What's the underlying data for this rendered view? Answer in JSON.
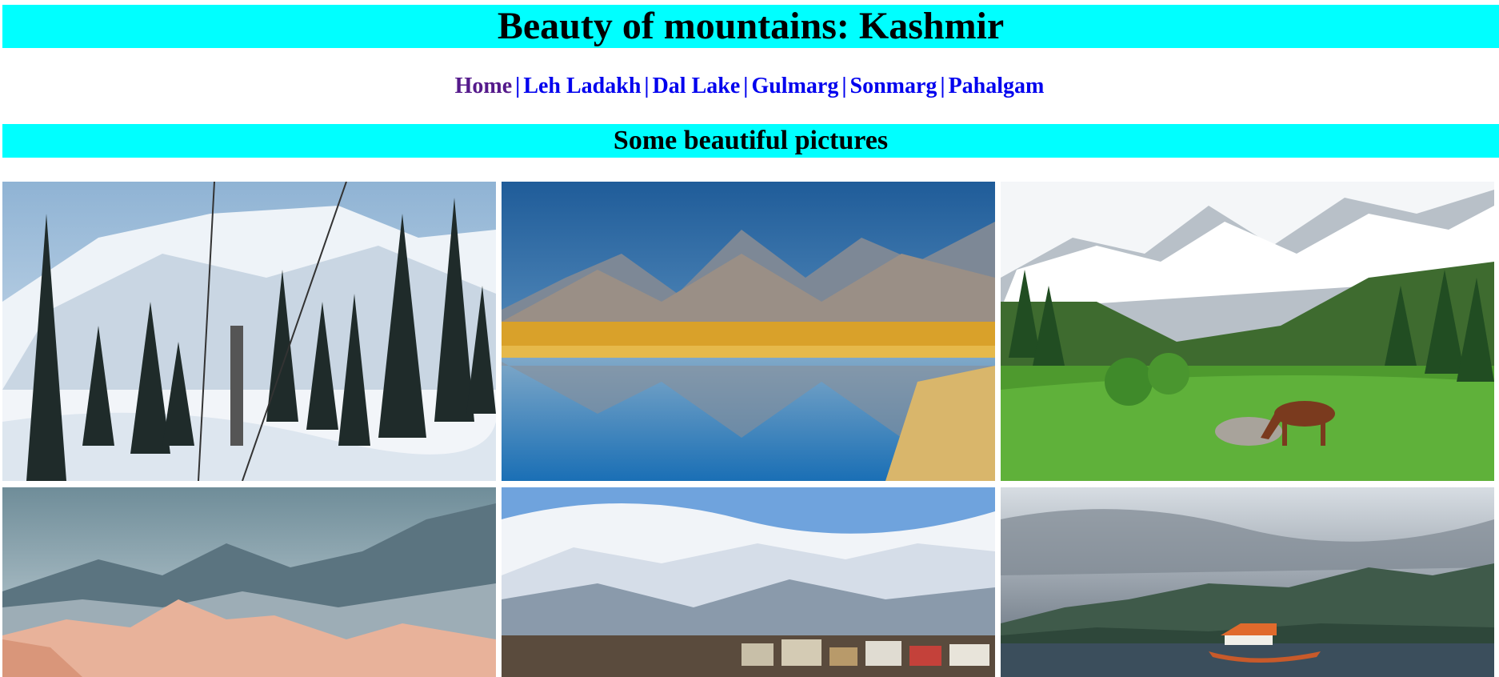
{
  "header": {
    "title": "Beauty of mountains: Kashmir"
  },
  "nav": {
    "items": [
      {
        "label": "Home",
        "color": "#551a8b"
      },
      {
        "label": "Leh Ladakh",
        "color": "#0000ee"
      },
      {
        "label": "Dal Lake",
        "color": "#0000ee"
      },
      {
        "label": "Gulmarg",
        "color": "#0000ee"
      },
      {
        "label": "Sonmarg",
        "color": "#0000ee"
      },
      {
        "label": "Pahalgam",
        "color": "#0000ee"
      }
    ],
    "separator": "|"
  },
  "section": {
    "heading": "Some beautiful pictures"
  },
  "colors": {
    "banner": "#00ffff",
    "link": "#0000ee",
    "visited": "#551a8b"
  },
  "gallery": {
    "images": [
      {
        "scene": "snowy-forest-gondola"
      },
      {
        "scene": "mountain-lake-reflection"
      },
      {
        "scene": "green-valley-horse"
      },
      {
        "scene": "misty-pink-peaks"
      },
      {
        "scene": "snow-range-town"
      },
      {
        "scene": "lake-shikara-boat"
      }
    ]
  }
}
